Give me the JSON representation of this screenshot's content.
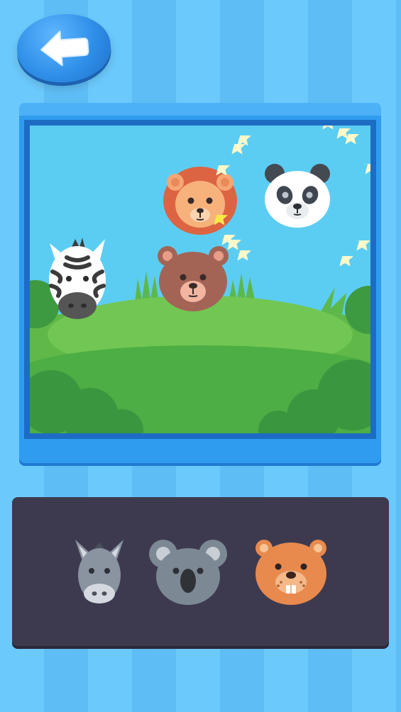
{
  "back_button": {
    "icon": "back-arrow-icon"
  },
  "scene": {
    "placed_animals": [
      {
        "name": "lion",
        "icon": "lion-face"
      },
      {
        "name": "panda",
        "icon": "panda-face"
      },
      {
        "name": "zebra",
        "icon": "zebra-face"
      },
      {
        "name": "bear",
        "icon": "bear-face"
      }
    ],
    "sparkle_effect": "star-trail"
  },
  "tray": {
    "animals": [
      {
        "name": "donkey",
        "icon": "donkey-face"
      },
      {
        "name": "koala",
        "icon": "koala-face"
      },
      {
        "name": "beaver",
        "icon": "beaver-face"
      }
    ]
  },
  "colors": {
    "background": "#6cc9fb",
    "frame": "#2f9cf0",
    "sky": "#5ccdf2",
    "grass": "#6cc24a",
    "tray": "#3d3a50"
  }
}
